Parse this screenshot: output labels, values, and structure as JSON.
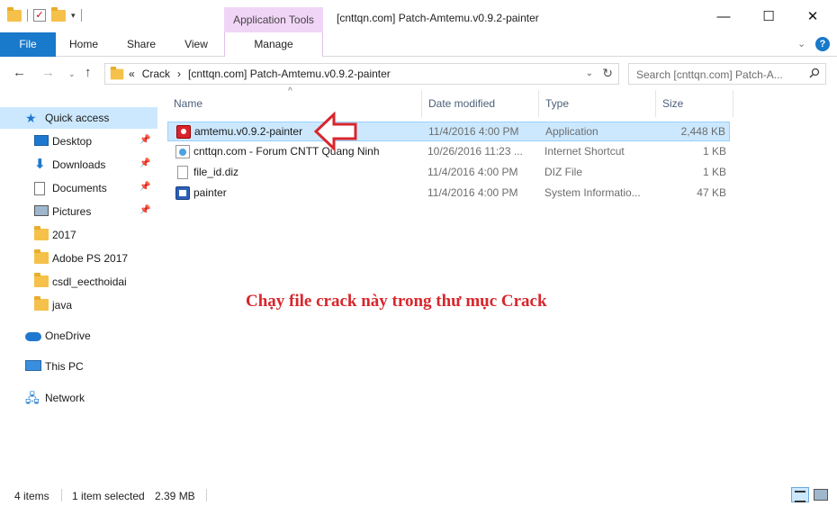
{
  "window": {
    "title": "[cnttqn.com] Patch-Amtemu.v0.9.2-painter",
    "contextual_group": "Application Tools",
    "controls": {
      "minimize": "—",
      "maximize": "☐",
      "close": "✕"
    }
  },
  "ribbon": {
    "tabs": {
      "file": "File",
      "home": "Home",
      "share": "Share",
      "view": "View",
      "manage": "Manage"
    },
    "expand_glyph": "⌄",
    "help_glyph": "?"
  },
  "address": {
    "overflow": "«",
    "crumbs": [
      "Crack",
      "›",
      "[cnttqn.com] Patch-Amtemu.v0.9.2-painter"
    ],
    "search_placeholder": "Search [cnttqn.com] Patch-A..."
  },
  "nav": {
    "quick_access": "Quick access",
    "items": [
      {
        "label": "Desktop",
        "icon": "desktop-icon",
        "pinned": true
      },
      {
        "label": "Downloads",
        "icon": "downloads-icon",
        "pinned": true
      },
      {
        "label": "Documents",
        "icon": "documents-icon",
        "pinned": true
      },
      {
        "label": "Pictures",
        "icon": "pictures-icon",
        "pinned": true
      },
      {
        "label": "2017",
        "icon": "folder-icon",
        "pinned": false
      },
      {
        "label": "Adobe PS 2017",
        "icon": "folder-icon",
        "pinned": false
      },
      {
        "label": "csdl_eecthoidai",
        "icon": "folder-icon",
        "pinned": false
      },
      {
        "label": "java",
        "icon": "folder-icon",
        "pinned": false
      }
    ],
    "onedrive": "OneDrive",
    "this_pc": "This PC",
    "network": "Network"
  },
  "columns": {
    "name": "Name",
    "date": "Date modified",
    "type": "Type",
    "size": "Size"
  },
  "files": [
    {
      "name": "amtemu.v0.9.2-painter",
      "date": "11/4/2016 4:00 PM",
      "type": "Application",
      "size": "2,448 KB",
      "icon": "application-icon",
      "selected": true
    },
    {
      "name": "cnttqn.com - Forum CNTT Quang Ninh",
      "date": "10/26/2016 11:23 ...",
      "type": "Internet Shortcut",
      "size": "1 KB",
      "icon": "internet-shortcut-icon",
      "selected": false
    },
    {
      "name": "file_id.diz",
      "date": "11/4/2016 4:00 PM",
      "type": "DIZ File",
      "size": "1 KB",
      "icon": "text-file-icon",
      "selected": false
    },
    {
      "name": "painter",
      "date": "11/4/2016 4:00 PM",
      "type": "System Informatio...",
      "size": "47 KB",
      "icon": "system-information-icon",
      "selected": false
    }
  ],
  "annotation": {
    "text": "Chạy file crack này trong thư mục Crack",
    "color": "#d8262c"
  },
  "status": {
    "count": "4 items",
    "selected": "1 item selected",
    "size": "2.39 MB"
  },
  "colors": {
    "accent": "#1979ca",
    "selection": "#cce8ff",
    "contextual": "#f1d5f7"
  }
}
